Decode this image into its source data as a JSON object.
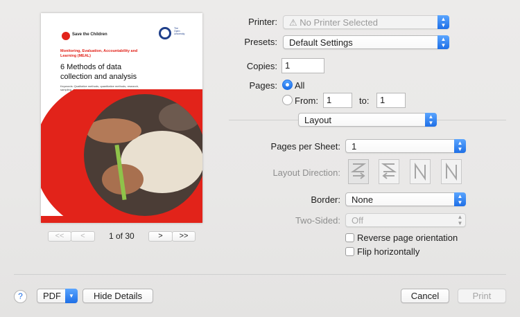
{
  "preview": {
    "org_name": "Save the Children",
    "university_name": "The Open University",
    "doc_series": "Monitoring, Evaluation, Accountability and Learning (MEAL)",
    "doc_title": "6 Methods of data collection and analysis",
    "doc_keywords": "Keywords: Qualitative methods, quantitative methods, research, sampling, data analysis",
    "page_indicator": "1 of 30",
    "first_label": "<<",
    "prev_label": "<",
    "next_label": ">",
    "last_label": ">>"
  },
  "printer": {
    "label": "Printer:",
    "value": "No Printer Selected"
  },
  "presets": {
    "label": "Presets:",
    "value": "Default Settings"
  },
  "copies": {
    "label": "Copies:",
    "value": "1"
  },
  "pages": {
    "label": "Pages:",
    "all_label": "All",
    "from_label": "From:",
    "from_value": "1",
    "to_label": "to:",
    "to_value": "1"
  },
  "section_popup": {
    "value": "Layout"
  },
  "layout": {
    "pages_per_sheet_label": "Pages per Sheet:",
    "pages_per_sheet_value": "1",
    "layout_direction_label": "Layout Direction:",
    "border_label": "Border:",
    "border_value": "None",
    "two_sided_label": "Two-Sided:",
    "two_sided_value": "Off",
    "reverse_label": "Reverse page orientation",
    "flip_label": "Flip horizontally"
  },
  "footer": {
    "help_label": "?",
    "pdf_label": "PDF",
    "hide_details_label": "Hide Details",
    "cancel_label": "Cancel",
    "print_label": "Print"
  },
  "colors": {
    "accent": "#1e6fe6",
    "brand_red": "#e2231a"
  }
}
